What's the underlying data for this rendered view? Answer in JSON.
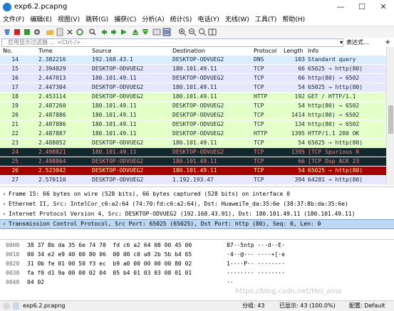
{
  "window": {
    "title": "exp6.2.pcapng",
    "minimize": "—",
    "maximize": "☐",
    "close": "✕"
  },
  "menu": [
    "文件(F)",
    "编辑(E)",
    "视图(V)",
    "跳转(G)",
    "捕获(C)",
    "分析(A)",
    "统计(S)",
    "电话(Y)",
    "无线(W)",
    "工具(T)",
    "帮助(H)"
  ],
  "filter": {
    "placeholder": "应用显示过滤器 … <Ctrl-/>",
    "expression_label": "表达式…",
    "plus": "+"
  },
  "columns": {
    "no": "No.",
    "time": "Time",
    "source": "Source",
    "destination": "Destination",
    "protocol": "Protocol",
    "length": "Length",
    "info": "Info"
  },
  "packets": [
    {
      "no": "14",
      "time": "2.382216",
      "src": "192.168.43.1",
      "dst": "DESKTOP-ODVUEG2",
      "proto": "DNS",
      "len": "103",
      "info": "Standard query",
      "bg": "#daeeff",
      "fg": "#12272e"
    },
    {
      "no": "15",
      "time": "2.394029",
      "src": "DESKTOP-ODVUEG2",
      "dst": "180.101.49.11",
      "proto": "TCP",
      "len": "66",
      "info": "65025 → http(80)",
      "bg": "#e7e6ff",
      "fg": "#12272e"
    },
    {
      "no": "16",
      "time": "2.447013",
      "src": "180.101.49.11",
      "dst": "DESKTOP-ODVUEG2",
      "proto": "TCP",
      "len": "66",
      "info": "http(80) → 6502",
      "bg": "#e7e6ff",
      "fg": "#12272e"
    },
    {
      "no": "17",
      "time": "2.447304",
      "src": "DESKTOP-ODVUEG2",
      "dst": "180.101.49.11",
      "proto": "TCP",
      "len": "54",
      "info": "65025 → http(80)",
      "bg": "#e7e6ff",
      "fg": "#12272e"
    },
    {
      "no": "18",
      "time": "2.453114",
      "src": "DESKTOP-ODVUEG2",
      "dst": "180.101.49.11",
      "proto": "HTTP",
      "len": "192",
      "info": "GET / HTTP/1.1",
      "bg": "#e4ffc7",
      "fg": "#12272e"
    },
    {
      "no": "19",
      "time": "2.487260",
      "src": "180.101.49.11",
      "dst": "DESKTOP-ODVUEG2",
      "proto": "TCP",
      "len": "54",
      "info": "http(80) → 6502",
      "bg": "#e4ffc7",
      "fg": "#12272e"
    },
    {
      "no": "20",
      "time": "2.487886",
      "src": "180.101.49.11",
      "dst": "DESKTOP-ODVUEG2",
      "proto": "TCP",
      "len": "1414",
      "info": "http(80) → 6502",
      "bg": "#e4ffc7",
      "fg": "#12272e"
    },
    {
      "no": "21",
      "time": "2.487886",
      "src": "180.101.49.11",
      "dst": "DESKTOP-ODVUEG2",
      "proto": "TCP",
      "len": "134",
      "info": "http(80) → 6502",
      "bg": "#e4ffc7",
      "fg": "#12272e"
    },
    {
      "no": "22",
      "time": "2.487887",
      "src": "180.101.49.11",
      "dst": "DESKTOP-ODVUEG2",
      "proto": "HTTP",
      "len": "1395",
      "info": "HTTP/1.1 200 OK",
      "bg": "#e4ffc7",
      "fg": "#12272e"
    },
    {
      "no": "23",
      "time": "2.488052",
      "src": "DESKTOP-ODVUEG2",
      "dst": "180.101.49.11",
      "proto": "TCP",
      "len": "54",
      "info": "65025 → http(80)",
      "bg": "#e4ffc7",
      "fg": "#12272e"
    },
    {
      "no": "24",
      "time": "2.498821",
      "src": "180.101.49.11",
      "dst": "DESKTOP-ODVUEG2",
      "proto": "TCP",
      "len": "1395",
      "info": "[TCP Spurious R",
      "bg": "#12272e",
      "fg": "#f78787"
    },
    {
      "no": "25",
      "time": "2.498864",
      "src": "DESKTOP-ODVUEG2",
      "dst": "180.101.49.11",
      "proto": "TCP",
      "len": "66",
      "info": "[TCP Dup ACK 23",
      "bg": "#12272e",
      "fg": "#f78787"
    },
    {
      "no": "26",
      "time": "2.523042",
      "src": "DESKTOP-ODVUEG2",
      "dst": "180.101.49.11",
      "proto": "TCP",
      "len": "54",
      "info": "65025 → http(80)",
      "bg": "#a40000",
      "fg": "#fffc9c"
    },
    {
      "no": "27",
      "time": "2.570110",
      "src": "DESKTOP-ODVUEG2",
      "dst": "1.192.193.47",
      "proto": "TCP",
      "len": "394",
      "info": "64281 → http(80)",
      "bg": "#e7e6ff",
      "fg": "#12272e"
    }
  ],
  "details": [
    {
      "text": "Frame 15: 66 bytes on wire (528 bits), 66 bytes captured (528 bits) on interface 0",
      "selected": false
    },
    {
      "text": "Ethernet II, Src: IntelCor_c6:a2:64 (74:70:fd:c6:a2:64), Dst: HuaweiTe_da:35:6e (38:37:8b:da:35:6e)",
      "selected": false
    },
    {
      "text": "Internet Protocol Version 4, Src: DESKTOP-ODVUEG2 (192.168.43.91), Dst: 180.101.49.11 (180.101.49.11)",
      "selected": false
    },
    {
      "text": "Transmission Control Protocol, Src Port: 65025 (65025), Dst Port: http (80), Seq: 0, Len: 0",
      "selected": true
    }
  ],
  "bytes": [
    {
      "off": "0000",
      "hex": "38 37 8b da 35 6e 74 70  fd c6 a2 64 08 00 45 00",
      "ascii": "87··5ntp ···d··E·"
    },
    {
      "off": "0010",
      "hex": "00 34 e2 e9 40 00 80 06  00 00 c0 a8 2b 5b b4 65",
      "ascii": "·4··@··· ····+[·e"
    },
    {
      "off": "0020",
      "hex": "31 0b fe 01 00 50 f3 ec  b9 a0 00 00 00 00 80 02",
      "ascii": "1····P·· ········"
    },
    {
      "off": "0030",
      "hex": "fa f0 d1 9a 00 00 02 04  05 b4 01 03 03 08 01 01",
      "ascii": "········ ········"
    },
    {
      "off": "0040",
      "hex": "04 02",
      "ascii": "··"
    }
  ],
  "status": {
    "file": "exp6.2.pcapng",
    "groups": "分组: 43",
    "displayed": "已显示: 43 (100.0%)",
    "profile": "配置: Default"
  },
  "watermark": "https://blog.csdn.net/Hel_aina"
}
